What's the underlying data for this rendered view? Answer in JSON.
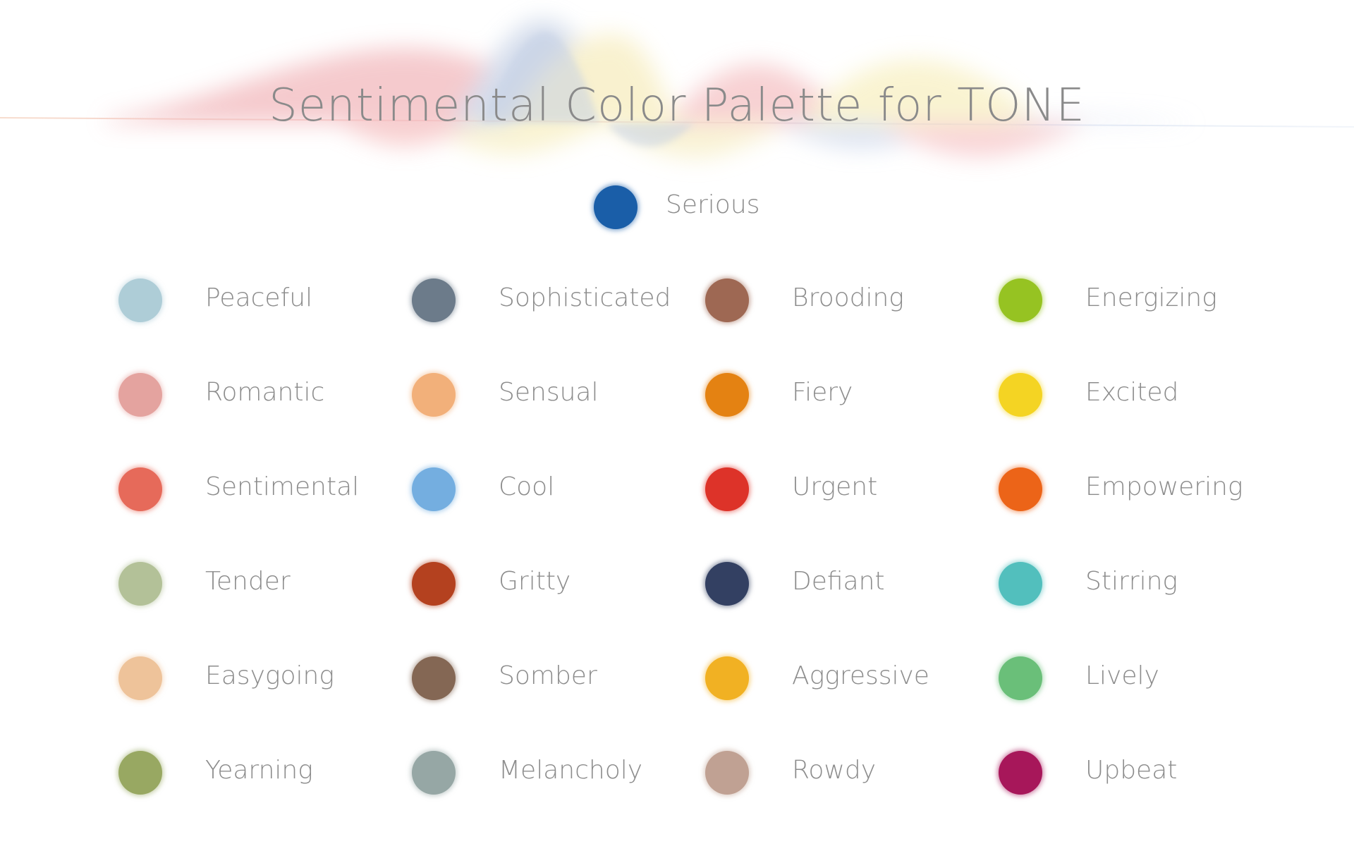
{
  "title": "Sentimental Color Palette for TONE",
  "featured": {
    "label": "Serious",
    "color": "#1a5ea8"
  },
  "columns": [
    [
      {
        "label": "Peaceful",
        "color": "#aecdd7"
      },
      {
        "label": "Romantic",
        "color": "#e4a39f"
      },
      {
        "label": "Sentimental",
        "color": "#e66a5a"
      },
      {
        "label": "Tender",
        "color": "#b3c198"
      },
      {
        "label": "Easygoing",
        "color": "#eec39a"
      },
      {
        "label": "Yearning",
        "color": "#98a862"
      }
    ],
    [
      {
        "label": "Sophisticated",
        "color": "#6c7b8a"
      },
      {
        "label": "Sensual",
        "color": "#f2b07a"
      },
      {
        "label": "Cool",
        "color": "#74aee0"
      },
      {
        "label": "Gritty",
        "color": "#b4411f"
      },
      {
        "label": "Somber",
        "color": "#846754"
      },
      {
        "label": "Melancholy",
        "color": "#96a7a5"
      }
    ],
    [
      {
        "label": "Brooding",
        "color": "#9e6853"
      },
      {
        "label": "Fiery",
        "color": "#e48212"
      },
      {
        "label": "Urgent",
        "color": "#dd3329"
      },
      {
        "label": "Defiant",
        "color": "#334062"
      },
      {
        "label": "Aggressive",
        "color": "#f1b123"
      },
      {
        "label": "Rowdy",
        "color": "#c0a193"
      }
    ],
    [
      {
        "label": "Energizing",
        "color": "#96c322"
      },
      {
        "label": "Excited",
        "color": "#f4d423"
      },
      {
        "label": "Empowering",
        "color": "#ec6418"
      },
      {
        "label": "Stirring",
        "color": "#52bfbd"
      },
      {
        "label": "Lively",
        "color": "#6abf79"
      },
      {
        "label": "Upbeat",
        "color": "#a7175a"
      }
    ]
  ]
}
